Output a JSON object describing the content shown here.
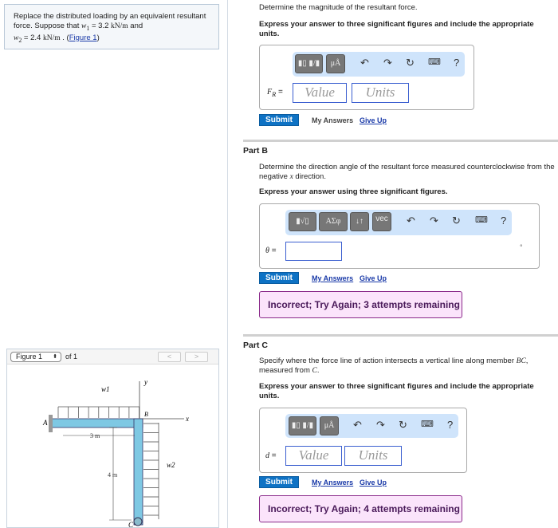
{
  "problem": {
    "text1": "Replace the distributed loading by an equivalent resultant force. Suppose that ",
    "w1": "w",
    "w1sub": "1",
    "w1val": " = 3.2 ",
    "unit": "kN/m",
    "and": " and",
    "w2": "w",
    "w2sub": "2",
    "w2val": " = 2.4 ",
    "figure_link": "Figure 1"
  },
  "figure": {
    "select": "Figure 1",
    "of": "of 1",
    "prev": "<",
    "next": ">",
    "labels": {
      "w1": "w1",
      "w2": "w2",
      "y": "y",
      "x": "x",
      "A": "A",
      "B": "B",
      "C": "C",
      "len_h": "3 m",
      "len_v": "4 m"
    }
  },
  "partA": {
    "question": "Determine the magnitude of the resultant force.",
    "instructions": "Express your answer to three significant figures and include the appropriate units.",
    "var": "F",
    "varsub": "R",
    "eq": " =",
    "value_placeholder": "Value",
    "units_placeholder": "Units",
    "submit": "Submit",
    "my_answers": "My Answers",
    "give_up": "Give Up",
    "toolbar": {
      "templates": "▮▯ ▮/▮",
      "units": "μÅ",
      "help": "?"
    }
  },
  "partB": {
    "title": "Part B",
    "question": "Determine the direction angle of the resultant force measured counterclockwise from the negative ",
    "qvar": "x",
    "qend": " direction.",
    "instructions": "Express your answer using three significant figures.",
    "var": "θ",
    "eq": " =",
    "unit_symbol": "°",
    "submit": "Submit",
    "my_answers": "My Answers",
    "give_up": "Give Up",
    "feedback": "Incorrect; Try Again; 3 attempts remaining",
    "toolbar": {
      "templates": "▮√▯",
      "greek": "ΑΣφ",
      "arrows": "↓↑",
      "vec": "vec",
      "help": "?"
    }
  },
  "partC": {
    "title": "Part C",
    "question1": "Specify where the force line of action intersects a vertical line along member ",
    "qvar": "BC",
    "question2": ",",
    "question3": "measured from ",
    "qvar2": "C",
    "qend": ".",
    "instructions": "Express your answer to three significant figures and include the appropriate units.",
    "var": "d",
    "eq": " =",
    "value_placeholder": "Value",
    "units_placeholder": "Units",
    "submit": "Submit",
    "my_answers": "My Answers",
    "give_up": "Give Up",
    "feedback": "Incorrect; Try Again; 4 attempts remaining",
    "toolbar": {
      "templates": "▮▯ ▮/▮",
      "units": "μÅ",
      "help": "?"
    }
  },
  "colors": {
    "accent": "#0e72c4",
    "toolbar": "#cfe4fb",
    "feedback_bg": "#fbe4fb",
    "feedback_border": "#8a2a8a",
    "beam": "#7ec8e3"
  }
}
